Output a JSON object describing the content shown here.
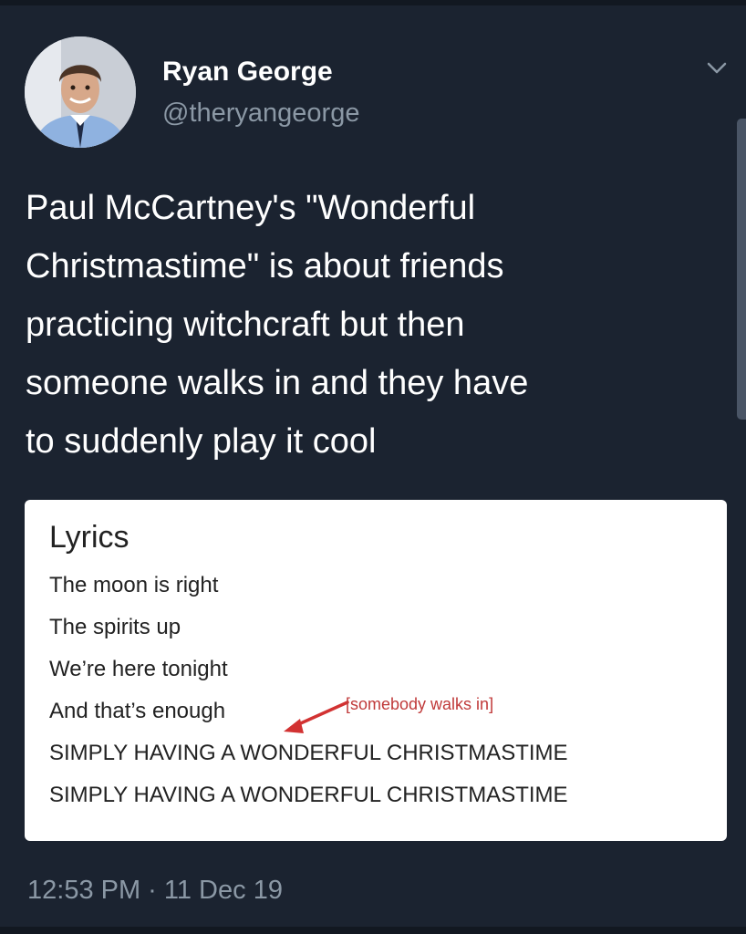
{
  "tweet": {
    "author": {
      "name": "Ryan George",
      "handle": "@theryangeorge",
      "avatar_icon": "person-avatar"
    },
    "menu_icon": "chevron-down-icon",
    "text_lines": [
      "Paul McCartney's \"Wonderful",
      "Christmastime\" is about friends",
      "practicing witchcraft but then",
      "someone walks in and they have",
      "to suddenly play it cool"
    ],
    "timestamp": "12:53 PM · 11 Dec 19"
  },
  "card": {
    "title": "Lyrics",
    "lines": [
      "The moon is right",
      "The spirits up",
      "We’re here tonight",
      "And that’s enough",
      "SIMPLY HAVING A WONDERFUL CHRISTMASTIME",
      "SIMPLY HAVING A WONDERFUL CHRISTMASTIME"
    ],
    "annotation": "[somebody walks in]",
    "annotation_color": "#c03a3a"
  },
  "colors": {
    "background": "#1b2330",
    "text": "#ffffff",
    "muted": "#8b98a5"
  }
}
